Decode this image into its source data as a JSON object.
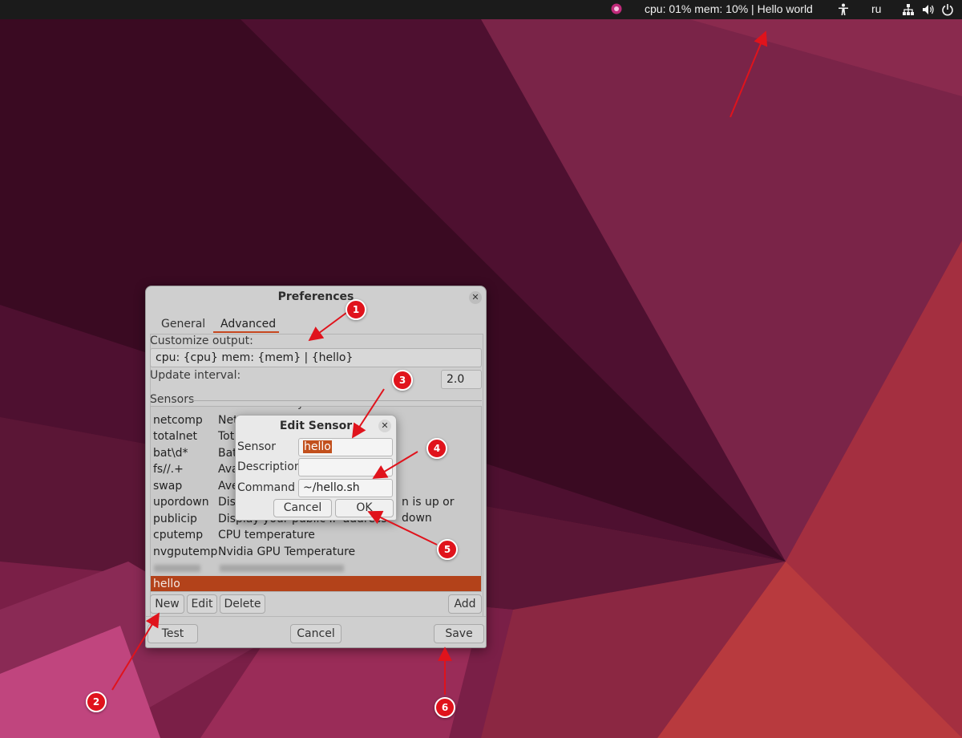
{
  "topbar": {
    "indicator_text": "cpu: 01% mem: 10% | Hello world",
    "language": "ru",
    "icons": [
      "app-indicator-icon",
      "accessibility-icon",
      "network-icon",
      "volume-icon",
      "power-icon"
    ]
  },
  "preferences": {
    "title": "Preferences",
    "tabs": [
      {
        "label": "General"
      },
      {
        "label": "Advanced"
      }
    ],
    "active_tab": "Advanced",
    "customize_label": "Customize output:",
    "customize_value": "cpu: {cpu} mem: {mem} | {hello}",
    "interval_label": "Update interval:",
    "interval_value": "2.0",
    "sensors_label": "Sensors",
    "sensors_partial_header": "y",
    "sensors": [
      {
        "name": "netcomp",
        "desc": "Net"
      },
      {
        "name": "totalnet",
        "desc": "Tota"
      },
      {
        "name": "bat\\d*",
        "desc": "Bat"
      },
      {
        "name": "fs//.+",
        "desc": "Ava"
      },
      {
        "name": "swap",
        "desc": "Ave"
      },
      {
        "name": "upordown",
        "desc": "Disp"
      },
      {
        "name": "publicip",
        "desc": "Display your public IP address"
      },
      {
        "name": "cputemp",
        "desc": "CPU temperature"
      },
      {
        "name": "nvgputemp",
        "desc": "Nvidia GPU Temperature"
      }
    ],
    "upordown_tail": "n is up or down",
    "selected_sensor": "hello",
    "buttons": {
      "new": "New",
      "edit": "Edit",
      "delete": "Delete",
      "add": "Add",
      "test": "Test",
      "cancel": "Cancel",
      "save": "Save"
    }
  },
  "edit_sensor": {
    "title": "Edit Sensor",
    "sensor_label": "Sensor",
    "sensor_value": "hello",
    "description_label": "Description",
    "description_value": "",
    "command_label": "Command",
    "command_value": "~/hello.sh",
    "cancel_label": "Cancel",
    "ok_label": "OK"
  },
  "annotations": {
    "markers": [
      "1",
      "2",
      "3",
      "4",
      "5",
      "6"
    ],
    "color": "#e0131c"
  },
  "colors": {
    "accent": "#c7471f",
    "selection": "#b3421a",
    "topbar": "#1b1b1b"
  }
}
